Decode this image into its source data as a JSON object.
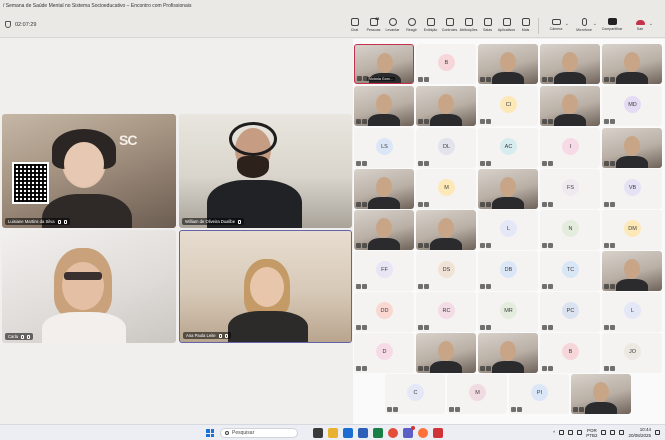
{
  "window": {
    "title": "/ Semana de Saúde Mental no Sistema Socioeducativo – Encontro com Profissionais"
  },
  "toolbar": {
    "timer": "02:07:29",
    "people_count": "48",
    "tools": [
      {
        "id": "chat",
        "label": "Chat",
        "icon": "chat-icon"
      },
      {
        "id": "people",
        "label": "Pessoas",
        "icon": "people-icon"
      },
      {
        "id": "raise",
        "label": "Levantar",
        "icon": "hand-icon"
      },
      {
        "id": "react",
        "label": "Reagir",
        "icon": "smile-icon"
      },
      {
        "id": "view",
        "label": "Exibição",
        "icon": "grid-icon"
      },
      {
        "id": "notes",
        "label": "Controles",
        "icon": "notes-icon"
      },
      {
        "id": "assign",
        "label": "Atribuições",
        "icon": "tasks-icon"
      },
      {
        "id": "rooms",
        "label": "Salas",
        "icon": "rooms-icon"
      },
      {
        "id": "apps",
        "label": "Aplicativos",
        "icon": "apps-icon"
      },
      {
        "id": "more",
        "label": "Mais",
        "icon": "more-icon"
      }
    ],
    "camera_label": "Câmera",
    "mic_label": "Microfone",
    "share_label": "Compartilhar",
    "leave_label": "Sair"
  },
  "stage": {
    "videos": [
      {
        "name": "Luisiane Martins da Silva"
      },
      {
        "name": "William de Oliveira Dualibe"
      },
      {
        "name": "Carla"
      },
      {
        "name": "Ana Paula Leite"
      }
    ],
    "logo_text": "SC"
  },
  "gallery": {
    "rows": [
      [
        {
          "type": "video",
          "name": "Victoria Gom...",
          "active": true
        },
        {
          "type": "avatar",
          "initials": "B",
          "color": "#f6d6d9"
        },
        {
          "type": "video"
        },
        {
          "type": "video"
        },
        {
          "type": "video"
        }
      ],
      [
        {
          "type": "video"
        },
        {
          "type": "video"
        },
        {
          "type": "avatar",
          "initials": "CI",
          "color": "#fde9b8"
        },
        {
          "type": "video"
        },
        {
          "type": "avatar",
          "initials": "MD",
          "color": "#e3dcf3"
        }
      ],
      [
        {
          "type": "avatar",
          "initials": "LS",
          "color": "#dbe7f7"
        },
        {
          "type": "avatar",
          "initials": "DL",
          "color": "#e2e3ec"
        },
        {
          "type": "avatar",
          "initials": "AC",
          "color": "#d6ecef"
        },
        {
          "type": "avatar",
          "initials": "I",
          "color": "#f6dbe6"
        },
        {
          "type": "video"
        }
      ],
      [
        {
          "type": "video"
        },
        {
          "type": "avatar",
          "initials": "M",
          "color": "#fde9b8"
        },
        {
          "type": "video"
        },
        {
          "type": "avatar",
          "initials": "FS",
          "color": "#eeeaf0"
        },
        {
          "type": "avatar",
          "initials": "VB",
          "color": "#e6e2f5"
        }
      ],
      [
        {
          "type": "video"
        },
        {
          "type": "video"
        },
        {
          "type": "avatar",
          "initials": "L",
          "color": "#e4e7f6"
        },
        {
          "type": "avatar",
          "initials": "N",
          "color": "#e4ecde"
        },
        {
          "type": "avatar",
          "initials": "DM",
          "color": "#fde9b8"
        }
      ],
      [
        {
          "type": "avatar",
          "initials": "FF",
          "color": "#e8e5f5"
        },
        {
          "type": "avatar",
          "initials": "DS",
          "color": "#f1e2d6"
        },
        {
          "type": "avatar",
          "initials": "DB",
          "color": "#dbe7f7"
        },
        {
          "type": "avatar",
          "initials": "TC",
          "color": "#d9e6f5"
        },
        {
          "type": "video"
        }
      ],
      [
        {
          "type": "avatar",
          "initials": "DD",
          "color": "#f9d8d2"
        },
        {
          "type": "avatar",
          "initials": "RC",
          "color": "#f3dce6"
        },
        {
          "type": "avatar",
          "initials": "MR",
          "color": "#e4ecde"
        },
        {
          "type": "avatar",
          "initials": "PC",
          "color": "#dbe3f0"
        },
        {
          "type": "avatar",
          "initials": "L",
          "color": "#e4e7f6"
        }
      ],
      [
        {
          "type": "avatar",
          "initials": "D",
          "color": "#f6dbe6"
        },
        {
          "type": "video"
        },
        {
          "type": "video"
        },
        {
          "type": "avatar",
          "initials": "B",
          "color": "#f6d6d9"
        },
        {
          "type": "avatar",
          "initials": "JO",
          "color": "#ece9e2"
        }
      ],
      [
        {
          "type": "avatar",
          "initials": "C",
          "color": "#e4e7f6"
        },
        {
          "type": "avatar",
          "initials": "M",
          "color": "#f1dbe2"
        },
        {
          "type": "avatar",
          "initials": "PI",
          "color": "#dbe7f7"
        },
        {
          "type": "video"
        }
      ]
    ]
  },
  "taskbar": {
    "search_placeholder": "Pesquisar",
    "lang_top": "POR",
    "lang_bottom": "PTB2",
    "time": "10:44",
    "date": "20/08/2025"
  }
}
